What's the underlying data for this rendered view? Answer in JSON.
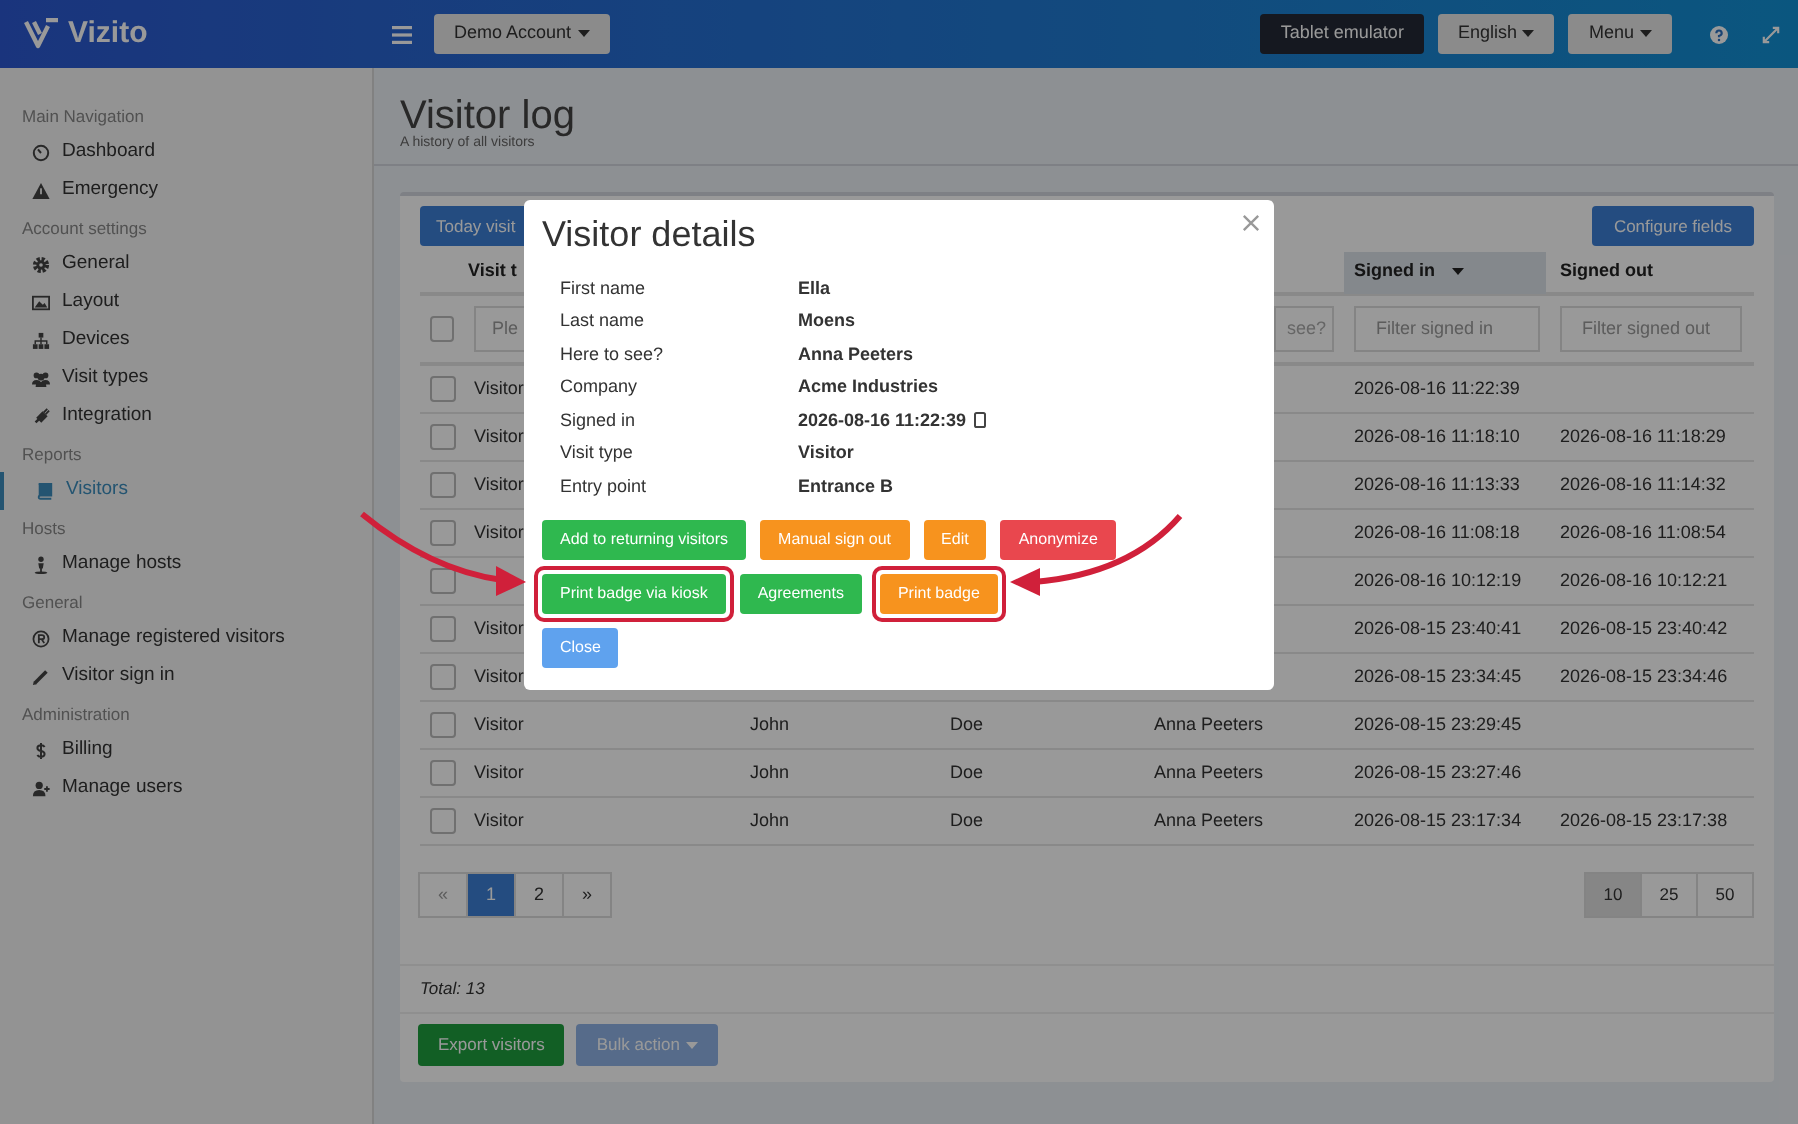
{
  "brand": {
    "name": "Vizito"
  },
  "topbar": {
    "account_button": "Demo Account",
    "buttons": [
      {
        "label": "Tablet emulator",
        "kind": "dark"
      },
      {
        "label": "English",
        "kind": "dropdown"
      },
      {
        "label": "Menu",
        "kind": "dropdown"
      }
    ]
  },
  "sidebar": {
    "sections": [
      {
        "title": "Main Navigation",
        "items": [
          {
            "label": "Dashboard",
            "kind": "gauge",
            "selected": false
          },
          {
            "label": "Emergency",
            "kind": "warning",
            "selected": false
          }
        ]
      },
      {
        "title": "Account settings",
        "items": [
          {
            "label": "General",
            "kind": "gear",
            "selected": false
          },
          {
            "label": "Layout",
            "kind": "image",
            "selected": false
          },
          {
            "label": "Devices",
            "kind": "sitemap",
            "selected": false
          },
          {
            "label": "Visit types",
            "kind": "users",
            "selected": false
          },
          {
            "label": "Integration",
            "kind": "plug",
            "selected": false
          }
        ]
      },
      {
        "title": "Reports",
        "items": [
          {
            "label": "Visitors",
            "kind": "book",
            "selected": true
          }
        ]
      },
      {
        "title": "Hosts",
        "items": [
          {
            "label": "Manage hosts",
            "kind": "person",
            "selected": false
          }
        ]
      },
      {
        "title": "General",
        "items": [
          {
            "label": "Manage registered visitors",
            "kind": "registered",
            "selected": false
          },
          {
            "label": "Visitor sign in",
            "kind": "pencil",
            "selected": false
          }
        ]
      },
      {
        "title": "Administration",
        "items": [
          {
            "label": "Billing",
            "kind": "dollar",
            "selected": false
          },
          {
            "label": "Manage users",
            "kind": "userplus",
            "selected": false
          }
        ]
      }
    ]
  },
  "page": {
    "title": "Visitor log",
    "subtitle": "A history of all visitors"
  },
  "toolbar": {
    "today_button": "Today visit",
    "configure_button": "Configure fields"
  },
  "table": {
    "columns": [
      {
        "kind": "visit_type",
        "label": "Visit t",
        "sorted": false
      },
      {
        "kind": "signed_in",
        "label": "Signed in",
        "sorted": true
      },
      {
        "kind": "signed_out",
        "label": "Signed out",
        "sorted": false
      }
    ],
    "select_all_checked": false,
    "filters": {
      "visit_type": "Ple",
      "host": "see?",
      "signed_in": "Filter signed in",
      "signed_out": "Filter signed out"
    },
    "rows": [
      {
        "checked": false,
        "visit_type": "Visitor",
        "signed_in": "2026-08-16 11:22:39"
      },
      {
        "checked": false,
        "visit_type": "Visitor",
        "signed_in": "2026-08-16 11:18:10",
        "signed_out": "2026-08-16 11:18:29"
      },
      {
        "checked": false,
        "visit_type": "Visitor",
        "signed_in": "2026-08-16 11:13:33",
        "signed_out": "2026-08-16 11:14:32"
      },
      {
        "checked": false,
        "visit_type": "Visitor",
        "signed_in": "2026-08-16 11:08:18",
        "signed_out": "2026-08-16 11:08:54"
      },
      {
        "checked": false,
        "signed_in": "2026-08-16 10:12:19",
        "signed_out": "2026-08-16 10:12:21"
      },
      {
        "checked": false,
        "visit_type": "Visitor",
        "signed_in": "2026-08-15 23:40:41",
        "signed_out": "2026-08-15 23:40:42"
      },
      {
        "checked": false,
        "visit_type": "Visitor",
        "signed_in": "2026-08-15 23:34:45",
        "signed_out": "2026-08-15 23:34:46"
      },
      {
        "checked": false,
        "visit_type": "Visitor",
        "first_name": "John",
        "last_name": "Doe",
        "host": "Anna Peeters",
        "signed_in": "2026-08-15 23:29:45"
      },
      {
        "checked": false,
        "visit_type": "Visitor",
        "first_name": "John",
        "last_name": "Doe",
        "host": "Anna Peeters",
        "signed_in": "2026-08-15 23:27:46"
      },
      {
        "checked": false,
        "visit_type": "Visitor",
        "first_name": "John",
        "last_name": "Doe",
        "host": "Anna Peeters",
        "signed_in": "2026-08-15 23:17:34",
        "signed_out": "2026-08-15 23:17:38"
      }
    ]
  },
  "pagination": [
    {
      "label": "«",
      "selected": false,
      "disabled": true
    },
    {
      "label": "1",
      "selected": true,
      "disabled": false
    },
    {
      "label": "2",
      "selected": false,
      "disabled": false
    },
    {
      "label": "»",
      "selected": false,
      "disabled": false
    }
  ],
  "page_sizes": [
    {
      "label": "10",
      "selected": true
    },
    {
      "label": "25",
      "selected": false
    },
    {
      "label": "50",
      "selected": false
    }
  ],
  "footer": {
    "total": "Total: 13",
    "buttons": [
      {
        "label": "Export visitors",
        "kind": "success"
      },
      {
        "label": "Bulk action",
        "kind": "dropdown"
      }
    ]
  },
  "modal": {
    "title": "Visitor details",
    "fields": [
      {
        "label": "First name",
        "value": "Ella"
      },
      {
        "label": "Last name",
        "value": "Moens"
      },
      {
        "label": "Here to see?",
        "value": "Anna Peeters"
      },
      {
        "label": "Company",
        "value": "Acme Industries"
      },
      {
        "label": "Signed in",
        "value": "2026-08-16 11:22:39",
        "kind": "device"
      },
      {
        "label": "Visit type",
        "value": "Visitor"
      },
      {
        "label": "Entry point",
        "value": "Entrance B"
      }
    ],
    "button_rows": [
      [
        {
          "label": "Add to returning visitors",
          "kind": "success",
          "highlighted": false
        },
        {
          "label": "Manual sign out",
          "kind": "warning",
          "highlighted": false
        },
        {
          "label": "Edit",
          "kind": "warning",
          "highlighted": false
        },
        {
          "label": "Anonymize",
          "kind": "danger",
          "highlighted": false
        }
      ],
      [
        {
          "label": "Print badge via kiosk",
          "kind": "success",
          "highlighted": true
        },
        {
          "label": "Agreements",
          "kind": "success",
          "highlighted": false
        },
        {
          "label": "Print badge",
          "kind": "warning",
          "highlighted": true
        }
      ],
      [
        {
          "label": "Close",
          "kind": "info",
          "highlighted": false
        }
      ]
    ]
  }
}
